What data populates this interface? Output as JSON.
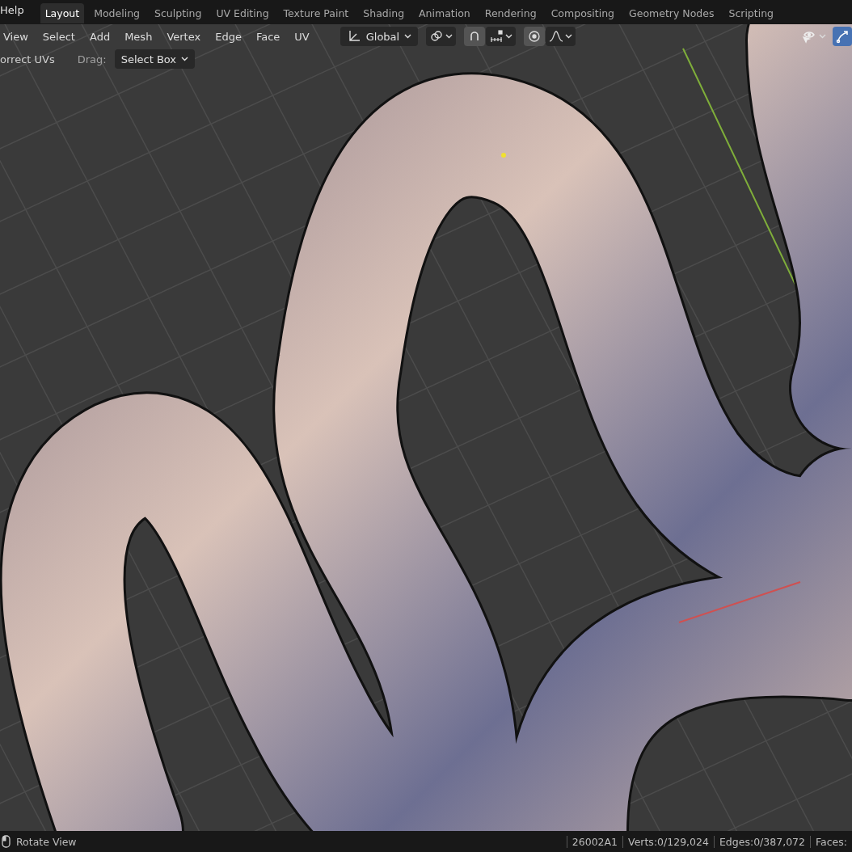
{
  "top_menu": {
    "label": "Help"
  },
  "workspace_tabs": [
    {
      "label": "Layout",
      "selected": true
    },
    {
      "label": "Modeling",
      "selected": false
    },
    {
      "label": "Sculpting",
      "selected": false
    },
    {
      "label": "UV Editing",
      "selected": false
    },
    {
      "label": "Texture Paint",
      "selected": false
    },
    {
      "label": "Shading",
      "selected": false
    },
    {
      "label": "Animation",
      "selected": false
    },
    {
      "label": "Rendering",
      "selected": false
    },
    {
      "label": "Compositing",
      "selected": false
    },
    {
      "label": "Geometry Nodes",
      "selected": false
    },
    {
      "label": "Scripting",
      "selected": false
    }
  ],
  "header_menus": [
    "View",
    "Select",
    "Add",
    "Mesh",
    "Vertex",
    "Edge",
    "Face",
    "UV"
  ],
  "header_tools": {
    "orientation": "Global",
    "snap_on": true,
    "proportional_on": true,
    "gizmo_on": true
  },
  "tool_settings": {
    "option": "orrect UVs",
    "drag_label": "Drag:",
    "drag_value": "Select Box"
  },
  "status_bar": {
    "hint": "Rotate View",
    "stats": [
      "26002A1",
      "Verts:0/129,024",
      "Edges:0/387,072",
      "Faces:"
    ]
  }
}
